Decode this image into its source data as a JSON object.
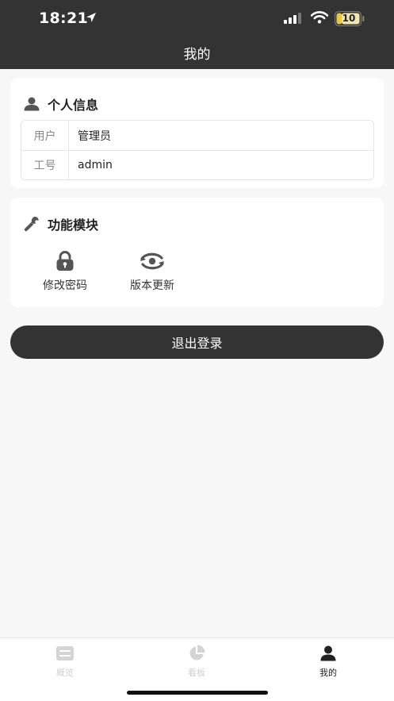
{
  "status_bar": {
    "time": "18:21",
    "battery": "10"
  },
  "nav": {
    "title": "我的"
  },
  "personal_info": {
    "title": "个人信息",
    "rows": [
      {
        "label": "用户",
        "value": "管理员"
      },
      {
        "label": "工号",
        "value": "admin"
      }
    ]
  },
  "modules": {
    "title": "功能模块",
    "items": [
      {
        "label": "修改密码",
        "icon": "lock-icon"
      },
      {
        "label": "版本更新",
        "icon": "refresh-icon"
      }
    ]
  },
  "logout_label": "退出登录",
  "tabbar": {
    "items": [
      {
        "label": "概览",
        "icon": "overview-icon",
        "active": false
      },
      {
        "label": "看板",
        "icon": "pie-chart-icon",
        "active": false
      },
      {
        "label": "我的",
        "icon": "user-icon",
        "active": true
      }
    ]
  },
  "colors": {
    "header_bg": "#333333",
    "page_bg": "#f7f7f7",
    "inactive_tab": "#cfcfcf"
  }
}
